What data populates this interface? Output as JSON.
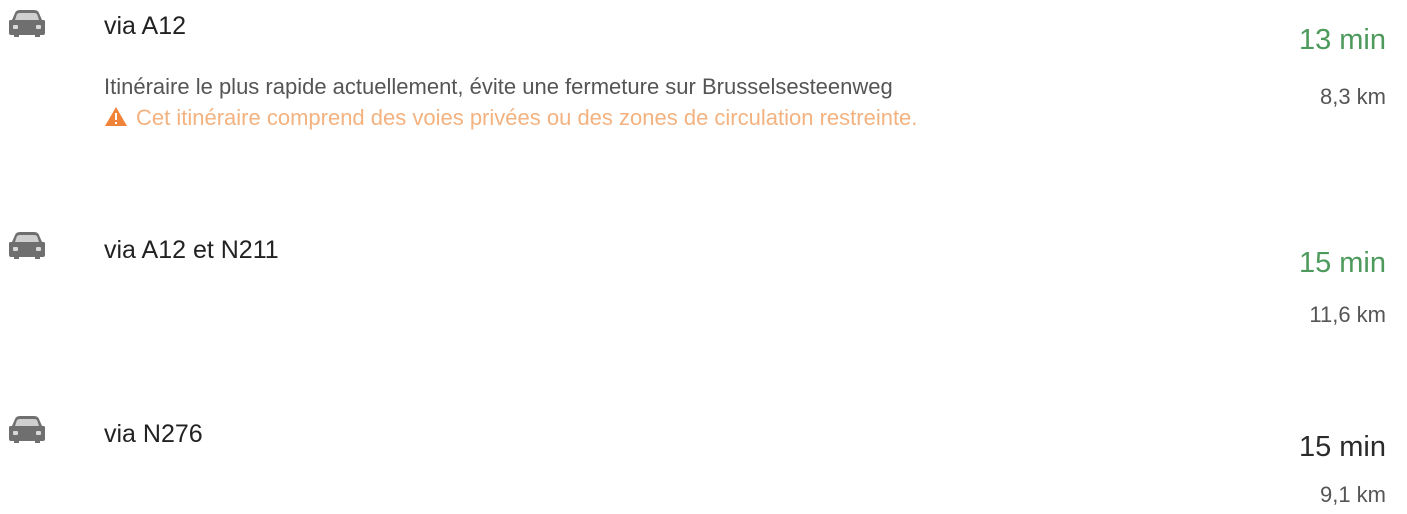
{
  "routes": [
    {
      "icon": "car-icon",
      "title": "via A12",
      "description": "Itinéraire le plus rapide actuellement, évite une fermeture sur Brusselsesteenweg",
      "warning": "Cet itinéraire comprend des voies privées ou des zones de circulation restreinte.",
      "warning_icon": "warning-triangle-icon",
      "time": "13 min",
      "distance": "8,3 km"
    },
    {
      "icon": "car-icon",
      "title": "via A12 et N211",
      "time": "15 min",
      "distance": "11,6 km"
    },
    {
      "icon": "car-icon",
      "title": "via N276",
      "time": "15 min",
      "distance": "9,1 km"
    }
  ],
  "colors": {
    "time_fast": "#4d9a5c",
    "time_normal": "#2b2b2b",
    "warning": "#f3b27f",
    "icon": "#6f6f6f"
  }
}
